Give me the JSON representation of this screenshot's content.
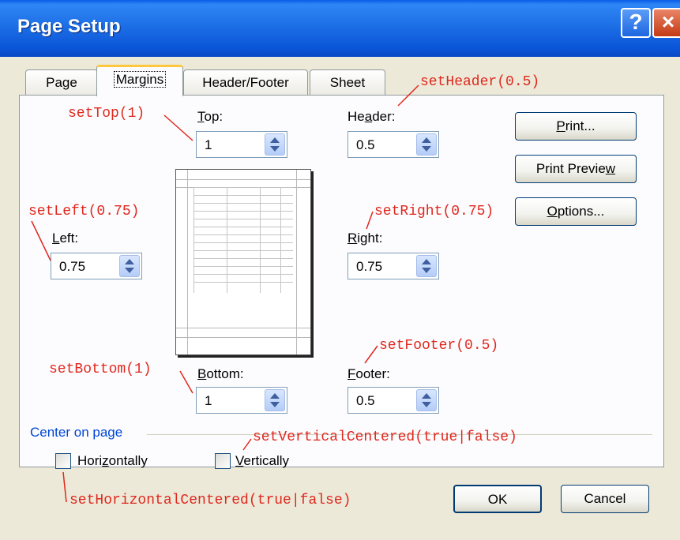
{
  "window": {
    "title": "Page Setup",
    "help_glyph": "?",
    "close_glyph": "×"
  },
  "tabs": [
    {
      "label": "Page"
    },
    {
      "label": "Margins",
      "active": true
    },
    {
      "label": "Header/Footer"
    },
    {
      "label": "Sheet"
    }
  ],
  "fields": {
    "top": {
      "label_u": "T",
      "label_rest": "op:",
      "value": "1"
    },
    "header": {
      "label_pre": "He",
      "label_u": "a",
      "label_rest": "der:",
      "value": "0.5"
    },
    "left": {
      "label_u": "L",
      "label_rest": "eft:",
      "value": "0.75"
    },
    "right": {
      "label_u": "R",
      "label_rest": "ight:",
      "value": "0.75"
    },
    "bottom": {
      "label_u": "B",
      "label_rest": "ottom:",
      "value": "1"
    },
    "footer": {
      "label_u": "F",
      "label_rest": "ooter:",
      "value": "0.5"
    }
  },
  "buttons": {
    "print": {
      "label_u": "P",
      "label_rest": "rint..."
    },
    "print_preview": {
      "label_pre": "Print Previe",
      "label_u": "w"
    },
    "options": {
      "label_u": "O",
      "label_rest": "ptions..."
    },
    "ok": "OK",
    "cancel": "Cancel"
  },
  "center_on_page": {
    "label": "Center on page",
    "horizontally": {
      "label_pre": "Hori",
      "label_u": "z",
      "label_rest": "ontally",
      "checked": false
    },
    "vertically": {
      "label_u": "V",
      "label_rest": "ertically",
      "checked": false
    }
  },
  "annotations": {
    "top": "setTop(1)",
    "header": "setHeader(0.5)",
    "left": "setLeft(0.75)",
    "right": "setRight(0.75)",
    "footer": "setFooter(0.5)",
    "bottom": "setBottom(1)",
    "vertical": "setVerticalCentered(true|false)",
    "horizontal": "setHorizontalCentered(true|false)"
  },
  "colors": {
    "annotation": "#e0281e",
    "group_label": "#0046d5",
    "titlebar": "#0a55d8"
  }
}
